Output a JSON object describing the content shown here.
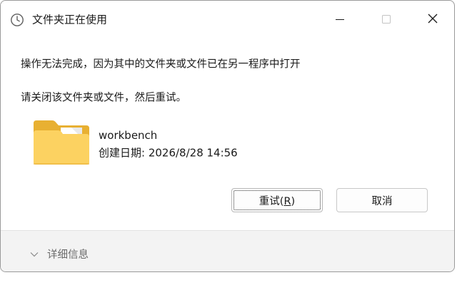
{
  "dialog": {
    "title": "文件夹正在使用",
    "title_icon": "clock-icon",
    "controls": {
      "minimize_icon": "minimize-icon",
      "maximize_icon": "maximize-icon",
      "close_icon": "close-icon"
    }
  },
  "message": {
    "line1": "操作无法完成，因为其中的文件夹或文件已在另一程序中打开",
    "line2": "请关闭该文件夹或文件，然后重试。"
  },
  "item": {
    "icon": "folder-icon",
    "name": "workbench",
    "date": "创建日期: 2026/8/28 14:56"
  },
  "buttons": {
    "retry_label_pre": "重试(",
    "retry_mnemonic": "R",
    "retry_label_post": ")",
    "cancel_label": "取消"
  },
  "footer": {
    "details_label": "详细信息",
    "details_icon": "chevron-down-icon"
  },
  "colors": {
    "folder_back": "#e8b032",
    "folder_front": "#fcd261",
    "text": "#1a1a1a",
    "muted_text": "#6b6b6b",
    "footer_bg": "#f3f3f3"
  }
}
